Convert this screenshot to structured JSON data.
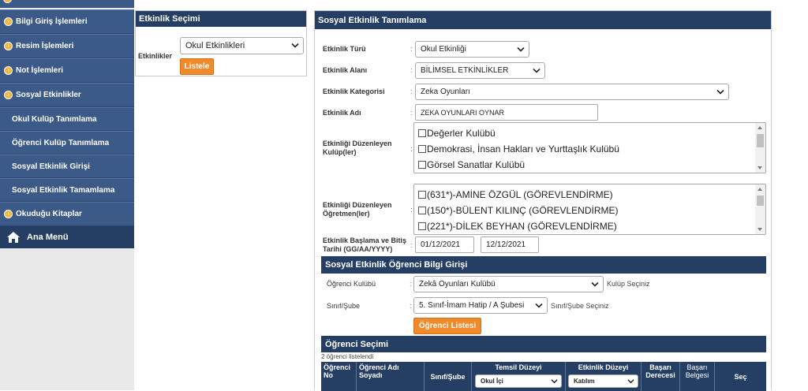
{
  "sidebar": {
    "items": [
      {
        "label": "Bilgi Giriş İşlemleri",
        "bullet": true
      },
      {
        "label": "Resim İşlemleri",
        "bullet": true
      },
      {
        "label": "Not İşlemleri",
        "bullet": true
      },
      {
        "label": "Sosyal Etkinlikler",
        "bullet": true
      },
      {
        "label": "Okul Kulüp Tanımlama",
        "bullet": false
      },
      {
        "label": "Öğrenci Kulüp Tanımlama",
        "bullet": false
      },
      {
        "label": "Sosyal Etkinlik Girişi",
        "bullet": false
      },
      {
        "label": "Sosyal Etkinlik Tamamlama",
        "bullet": false
      },
      {
        "label": "Okuduğu Kitaplar",
        "bullet": true
      }
    ],
    "home_label": "Ana Menü"
  },
  "etkinlik_secimi": {
    "title": "Etkinlik Seçimi",
    "label": "Etkinlikler",
    "selected": "Okul Etkinlikleri",
    "button": "Listele"
  },
  "tanimlama": {
    "title": "Sosyal Etkinlik Tanımlama",
    "fields": {
      "tur_label": "Etkinlik Türü",
      "tur_value": "Okul Etkinliği",
      "alan_label": "Etkinlik Alanı",
      "alan_value": "BİLİMSEL ETKİNLİKLER",
      "kategori_label": "Etkinlik Kategorisi",
      "kategori_value": "Zeka Oyunları",
      "ad_label": "Etkinlik Adı",
      "ad_value": "ZEKA OYUNLARI OYNAR",
      "kulup_label": "Etkinliği Düzenleyen Kulüp(ler)",
      "ogretmen_label": "Etkinliği Düzenleyen Öğretmen(ler)",
      "tarih_label": "Etkinlik Başlama ve Bitiş Tarihi (GG/AA/YYYY)",
      "baslama": "01/12/2021",
      "bitis": "12/12/2021",
      "colon": ":"
    },
    "kulupler": [
      "Değerler Kulübü",
      "Demokrasi, İnsan Hakları ve Yurttaşlık Kulübü",
      "Görsel Sanatlar Kulübü"
    ],
    "ogretmenler": [
      "(631*)-AMİNE ÖZGÜL (GÖREVLENDİRME)",
      "(150*)-BÜLENT KILINÇ (GÖREVLENDİRME)",
      "(221*)-DİLEK BEYHAN (GÖREVLENDİRME)"
    ]
  },
  "ogrenci_bilgi": {
    "title": "Sosyal Etkinlik Öğrenci Bilgi Girişi",
    "kulup_label": "Öğrenci Kulübü",
    "kulup_value": "Zekâ Oyunları Kulübü",
    "kulup_hint": "Kulüp Seçiniz",
    "sube_label": "Sınıf/Şube",
    "sube_value": "5. Sınıf-İmam Hatip / A Şubesi",
    "sube_hint": "Sınıf/Şube Seçiniz",
    "button": "Öğrenci Listesi"
  },
  "ogrenci_secimi": {
    "title": "Öğrenci Seçimi",
    "count_text": "2 öğrenci listelendi",
    "columns": {
      "no": "Öğrenci No",
      "ad": "Öğrenci Adı Soyadı",
      "sinif": "Sınıf/Şube",
      "temsil": "Temsil Düzeyi",
      "temsil_value": "Okul İçi",
      "etkinlik": "Etkinlik Düzeyi",
      "etkinlik_value": "Katılım",
      "derece": "Başarı Derecesi",
      "belge": "Başarı Belgesi",
      "sec": "Seç"
    }
  },
  "colors": {
    "navy": "#253e63",
    "sidebar_blue": "#3b5a88",
    "orange": "#f08a2a",
    "bullet": "#f0b53a"
  }
}
